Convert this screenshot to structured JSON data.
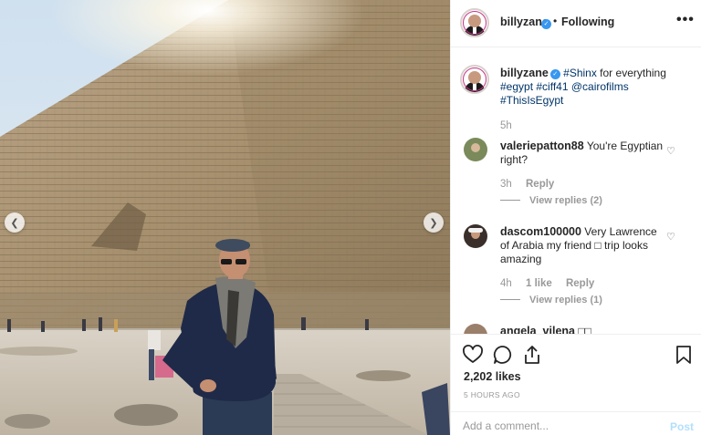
{
  "post": {
    "author": "billyzane",
    "follow_status": "Following",
    "more_options": "•••",
    "separator": "•"
  },
  "caption": {
    "author": "billyzane",
    "parts": [
      {
        "text": "#Shinx",
        "tag": true
      },
      {
        "text": " for everything ",
        "tag": false
      },
      {
        "text": "#egypt",
        "tag": true
      },
      {
        "text": " ",
        "tag": false
      },
      {
        "text": "#ciff41",
        "tag": true
      },
      {
        "text": " ",
        "tag": false
      },
      {
        "text": "@cairofilms",
        "tag": true
      },
      {
        "text": " ",
        "tag": false
      },
      {
        "text": "#ThisIsEgypt",
        "tag": true
      }
    ],
    "time": "5h"
  },
  "comments": [
    {
      "user": "valeriepatton88",
      "text": "You're Egyptian right?",
      "time": "3h",
      "likes": "",
      "reply_label": "Reply",
      "view_replies": "View replies (2)",
      "avatar_color": "#7a8a5a"
    },
    {
      "user": "dascom100000",
      "text": "Very Lawrence of Arabia my friend □ trip looks amazing",
      "time": "4h",
      "likes": "1 like",
      "reply_label": "Reply",
      "view_replies": "View replies (1)",
      "avatar_color": "#3a2f2a"
    },
    {
      "user": "angela_vilena",
      "text": "□□",
      "time": "",
      "likes": "",
      "reply_label": "",
      "view_replies": "",
      "avatar_color": "#9a7f6b"
    }
  ],
  "actions": {
    "like_icon": "heart-icon",
    "comment_icon": "comment-icon",
    "share_icon": "share-icon",
    "save_icon": "bookmark-icon",
    "likes": "2,202 likes",
    "timestamp": "5 HOURS AGO"
  },
  "add_comment": {
    "placeholder": "Add a comment...",
    "post_label": "Post"
  },
  "photo": {
    "prev_arrow": "❮",
    "next_arrow": "❯"
  },
  "colors": {
    "link": "#003569",
    "verified": "#3897f0",
    "post_disabled": "#b2dffc"
  }
}
